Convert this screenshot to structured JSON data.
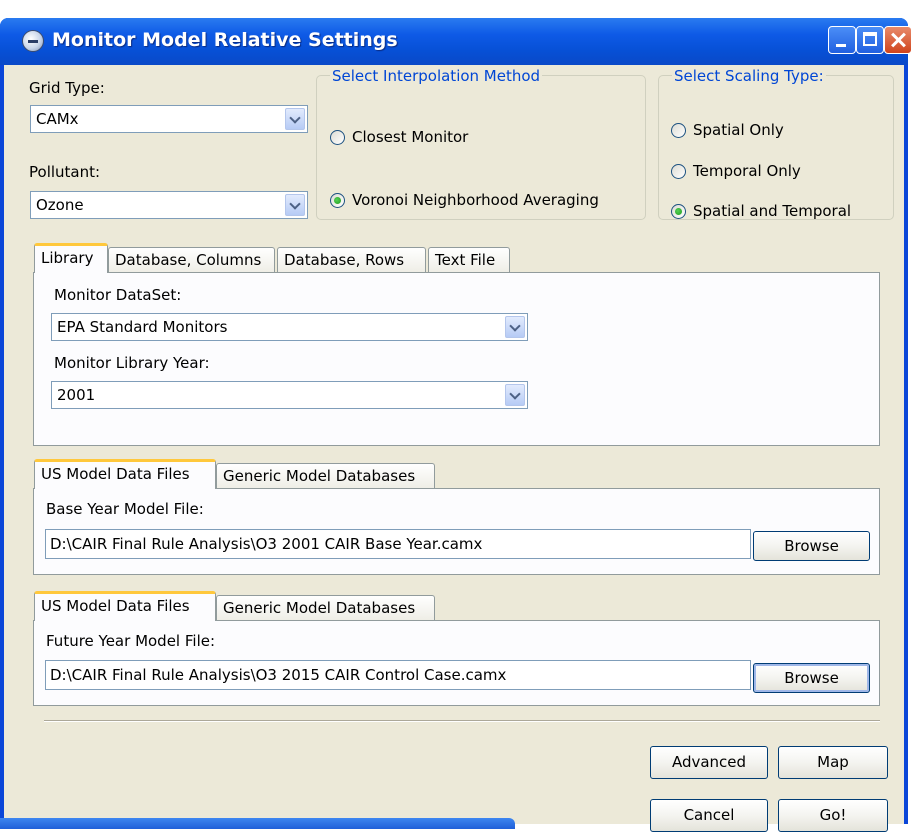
{
  "window": {
    "title": "Monitor Model Relative Settings"
  },
  "grid_type": {
    "label": "Grid Type:",
    "value": "CAMx"
  },
  "pollutant": {
    "label": "Pollutant:",
    "value": "Ozone"
  },
  "interpolation": {
    "title": "Select Interpolation Method",
    "options": [
      {
        "label": "Closest Monitor",
        "selected": false
      },
      {
        "label": "Voronoi Neighborhood Averaging",
        "selected": true
      }
    ]
  },
  "scaling": {
    "title": "Select Scaling Type:",
    "options": [
      {
        "label": "Spatial Only",
        "selected": false
      },
      {
        "label": "Temporal Only",
        "selected": false
      },
      {
        "label": "Spatial and Temporal",
        "selected": true
      }
    ]
  },
  "monitor_tabs": {
    "tabs": [
      "Library",
      "Database, Columns",
      "Database, Rows",
      "Text File"
    ],
    "active": "Library",
    "dataset_label": "Monitor DataSet:",
    "dataset_value": "EPA Standard Monitors",
    "year_label": "Monitor Library Year:",
    "year_value": "2001"
  },
  "base_model": {
    "tabs": [
      "US Model Data Files",
      "Generic Model Databases"
    ],
    "active": "US Model Data Files",
    "label": "Base Year Model File:",
    "path": "D:\\CAIR Final Rule Analysis\\O3 2001 CAIR Base Year.camx",
    "browse": "Browse"
  },
  "future_model": {
    "tabs": [
      "US Model Data Files",
      "Generic Model Databases"
    ],
    "active": "US Model Data Files",
    "label": "Future Year Model File:",
    "path": "D:\\CAIR Final Rule Analysis\\O3 2015 CAIR Control Case.camx",
    "browse": "Browse"
  },
  "buttons": {
    "advanced": "Advanced",
    "map": "Map",
    "cancel": "Cancel",
    "go": "Go!"
  },
  "icons": [
    "app-icon",
    "minimize-icon",
    "maximize-icon",
    "close-icon",
    "chevron-down-icon"
  ],
  "colors": {
    "title_bar": "#0a50d8",
    "group_title": "#0046d5",
    "active_tab": "#ffc83c",
    "radio_on": "#1f9a1f"
  }
}
